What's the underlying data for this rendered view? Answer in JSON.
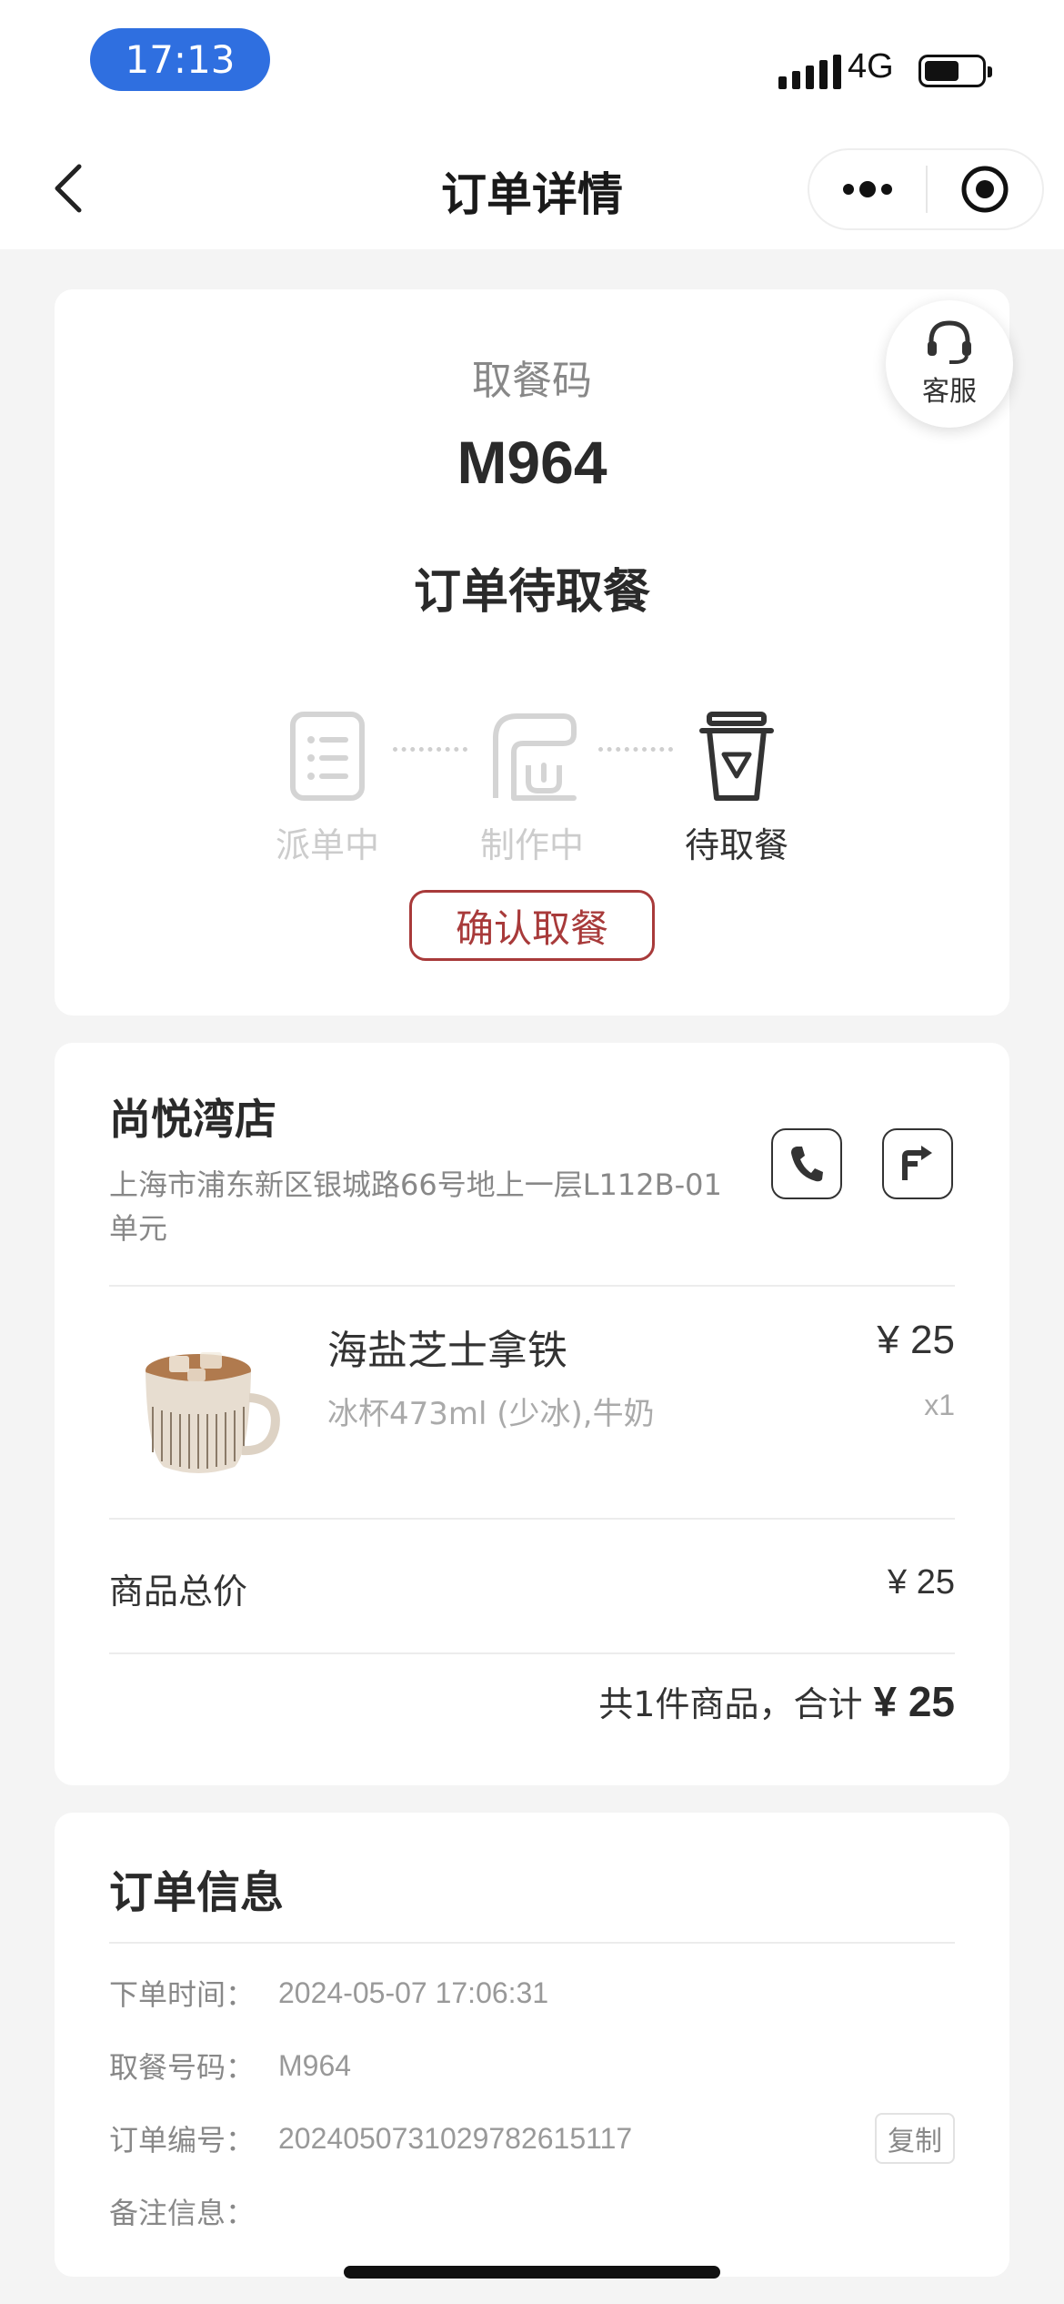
{
  "status_bar": {
    "time": "17:13",
    "network": "4G"
  },
  "nav": {
    "title": "订单详情"
  },
  "pickup": {
    "label": "取餐码",
    "code": "M964",
    "status": "订单待取餐",
    "steps": [
      {
        "label": "派单中",
        "icon": "list-icon",
        "active": false
      },
      {
        "label": "制作中",
        "icon": "coffee-machine-icon",
        "active": false
      },
      {
        "label": "待取餐",
        "icon": "cup-icon",
        "active": true
      }
    ],
    "confirm_label": "确认取餐",
    "service_label": "客服"
  },
  "store": {
    "name": "尚悦湾店",
    "address": "上海市浦东新区银城路66号地上一层L112B-01单元",
    "product": {
      "name": "海盐芝士拿铁",
      "options": "冰杯473ml (少冰),牛奶",
      "price": "¥ 25",
      "qty": "x1"
    },
    "subtotal_label": "商品总价",
    "subtotal_value": "¥ 25",
    "total_text": "共1件商品，合计",
    "total_value": "¥ 25"
  },
  "order_info": {
    "title": "订单信息",
    "rows": [
      {
        "key": "下单时间：",
        "value": "2024-05-07 17:06:31"
      },
      {
        "key": "取餐号码：",
        "value": "M964"
      },
      {
        "key": "订单编号：",
        "value": "20240507310297826151​17"
      },
      {
        "key": "备注信息：",
        "value": ""
      }
    ],
    "copy_label": "复制"
  },
  "colors": {
    "accent": "#a83a3a",
    "time_pill": "#2f6fe0"
  }
}
